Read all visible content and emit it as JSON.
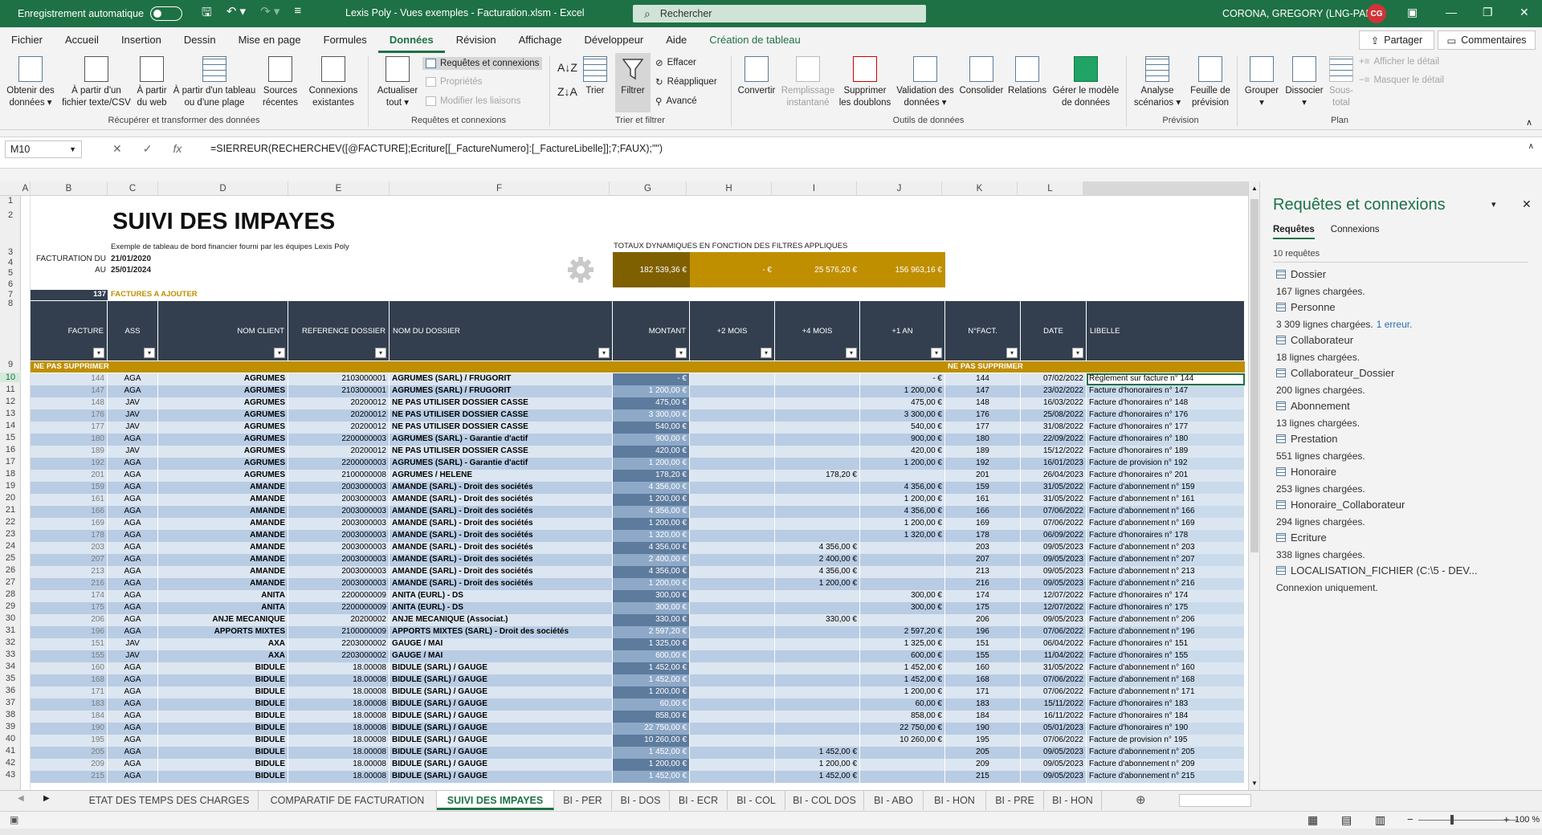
{
  "titlebar": {
    "autosave": "Enregistrement automatique",
    "title": "Lexis Poly - Vues exemples - Facturation.xlsm  -  Excel",
    "search": "Rechercher",
    "user": "CORONA, GREGORY (LNG-PAR)",
    "initials": "CG"
  },
  "menu": [
    "Fichier",
    "Accueil",
    "Insertion",
    "Dessin",
    "Mise en page",
    "Formules",
    "Données",
    "Révision",
    "Affichage",
    "Développeur",
    "Aide",
    "Création de tableau"
  ],
  "share": "Partager",
  "comments": "Commentaires",
  "ribbon": {
    "obtenir": "Obtenir des\ndonnées ▾",
    "texte": "À partir d'un\nfichier texte/CSV",
    "web": "À partir\ndu web",
    "tableau": "À partir d'un tableau\nou d'une plage",
    "sources": "Sources\nrécentes",
    "connexions": "Connexions\nexistantes",
    "actualiser": "Actualiser\ntout ▾",
    "req_conn": "Requêtes et connexions",
    "proprietes": "Propriétés",
    "modifier": "Modifier les liaisons",
    "trier": "Trier",
    "filtrer": "Filtrer",
    "effacer": "Effacer",
    "reappliquer": "Réappliquer",
    "avance": "Avancé",
    "convertir": "Convertir",
    "remplissage": "Remplissage\ninstantané",
    "supprimer": "Supprimer\nles doublons",
    "validation": "Validation des\ndonnées ▾",
    "consolider": "Consolider",
    "relations": "Relations",
    "modele": "Gérer le modèle\nde données",
    "analyse": "Analyse\nscénarios ▾",
    "feuille": "Feuille de\nprévision",
    "grouper": "Grouper\n▾",
    "dissocier": "Dissocier\n▾",
    "soustotal": "Sous-\ntotal",
    "afficher": "Afficher le détail",
    "masquer": "Masquer le détail",
    "g1": "Récupérer et transformer des données",
    "g2": "Requêtes et connexions",
    "g3": "Trier et filtrer",
    "g4": "Outils de données",
    "g5": "Prévision",
    "g6": "Plan"
  },
  "formula": {
    "cell": "M10",
    "text": "=SIERREUR(RECHERCHEV([@FACTURE];Ecriture[[_FactureNumero]:[_FactureLibelle]];7;FAUX);\"\")"
  },
  "columns": [
    "A",
    "B",
    "C",
    "D",
    "E",
    "F",
    "G",
    "H",
    "I",
    "J",
    "K",
    "L"
  ],
  "rows": [
    "1",
    "2",
    "3",
    "4",
    "5",
    "6",
    "7",
    "8",
    "9",
    "10",
    "11",
    "12",
    "13",
    "14",
    "15",
    "16",
    "17",
    "18",
    "19",
    "20",
    "21",
    "22",
    "23",
    "24",
    "25",
    "26",
    "27",
    "28",
    "29",
    "30",
    "31",
    "32",
    "33",
    "34",
    "35",
    "36",
    "37",
    "38",
    "39",
    "40",
    "41",
    "42",
    "43"
  ],
  "sheet": {
    "title": "SUIVI DES IMPAYES",
    "subtitle": "Exemple de tableau de bord financier fourni par les équipes Lexis Poly",
    "fact_du_label": "FACTURATION DU",
    "fact_du": "21/01/2020",
    "au_label": "AU",
    "au": "25/01/2024",
    "totaux_label": "TOTAUX DYNAMIQUES EN FONCTION DES FILTRES APPLIQUES",
    "totals": [
      "182 539,36 €",
      "-   €",
      "25 576,20 €",
      "156 963,16 €"
    ],
    "count": "137",
    "count_label": "FACTURES A AJOUTER",
    "headers": [
      "FACTURE",
      "ASS",
      "NOM CLIENT",
      "REFERENCE DOSSIER",
      "NOM DU DOSSIER",
      "MONTANT",
      "+2 MOIS",
      "+4 MOIS",
      "+1 AN",
      "N°FACT.",
      "DATE",
      "LIBELLE"
    ],
    "band": "NE PAS SUPPRIMER",
    "band2": "NE PAS SUPPRIMER"
  },
  "data": [
    [
      "144",
      "AGA",
      "AGRUMES",
      "2103000001",
      "AGRUMES (SARL) / FRUGORIT",
      "-   €",
      "",
      "",
      "-   €",
      "144",
      "07/02/2022",
      "Règlement sur facture n° 144"
    ],
    [
      "147",
      "AGA",
      "AGRUMES",
      "2103000001",
      "AGRUMES (SARL) / FRUGORIT",
      "1 200,00 €",
      "",
      "",
      "1 200,00 €",
      "147",
      "23/02/2022",
      "Facture d'honoraires n° 147"
    ],
    [
      "148",
      "JAV",
      "AGRUMES",
      "20200012",
      "NE PAS UTILISER DOSSIER CASSE",
      "475,00 €",
      "",
      "",
      "475,00 €",
      "148",
      "16/03/2022",
      "Facture d'honoraires n° 148"
    ],
    [
      "176",
      "JAV",
      "AGRUMES",
      "20200012",
      "NE PAS UTILISER DOSSIER CASSE",
      "3 300,00 €",
      "",
      "",
      "3 300,00 €",
      "176",
      "25/08/2022",
      "Facture d'honoraires n° 176"
    ],
    [
      "177",
      "JAV",
      "AGRUMES",
      "20200012",
      "NE PAS UTILISER DOSSIER CASSE",
      "540,00 €",
      "",
      "",
      "540,00 €",
      "177",
      "31/08/2022",
      "Facture d'honoraires n° 177"
    ],
    [
      "180",
      "AGA",
      "AGRUMES",
      "2200000003",
      "AGRUMES (SARL) - Garantie d'actif",
      "900,00 €",
      "",
      "",
      "900,00 €",
      "180",
      "22/09/2022",
      "Facture d'honoraires n° 180"
    ],
    [
      "189",
      "JAV",
      "AGRUMES",
      "20200012",
      "NE PAS UTILISER DOSSIER CASSE",
      "420,00 €",
      "",
      "",
      "420,00 €",
      "189",
      "15/12/2022",
      "Facture d'honoraires n° 189"
    ],
    [
      "192",
      "AGA",
      "AGRUMES",
      "2200000003",
      "AGRUMES (SARL) - Garantie d'actif",
      "1 200,00 €",
      "",
      "",
      "1 200,00 €",
      "192",
      "16/01/2023",
      "Facture de provision n° 192"
    ],
    [
      "201",
      "AGA",
      "AGRUMES",
      "2100000008",
      "AGRUMES / HELENE",
      "178,20 €",
      "",
      "178,20 €",
      "",
      "201",
      "26/04/2023",
      "Facture d'honoraires n° 201"
    ],
    [
      "159",
      "AGA",
      "AMANDE",
      "2003000003",
      "AMANDE (SARL) - Droit des sociétés",
      "4 356,00 €",
      "",
      "",
      "4 356,00 €",
      "159",
      "31/05/2022",
      "Facture d'abonnement n° 159"
    ],
    [
      "161",
      "AGA",
      "AMANDE",
      "2003000003",
      "AMANDE (SARL) - Droit des sociétés",
      "1 200,00 €",
      "",
      "",
      "1 200,00 €",
      "161",
      "31/05/2022",
      "Facture d'abonnement n° 161"
    ],
    [
      "166",
      "AGA",
      "AMANDE",
      "2003000003",
      "AMANDE (SARL) - Droit des sociétés",
      "4 356,00 €",
      "",
      "",
      "4 356,00 €",
      "166",
      "07/06/2022",
      "Facture d'abonnement n° 166"
    ],
    [
      "169",
      "AGA",
      "AMANDE",
      "2003000003",
      "AMANDE (SARL) - Droit des sociétés",
      "1 200,00 €",
      "",
      "",
      "1 200,00 €",
      "169",
      "07/06/2022",
      "Facture d'abonnement n° 169"
    ],
    [
      "178",
      "AGA",
      "AMANDE",
      "2003000003",
      "AMANDE (SARL) - Droit des sociétés",
      "1 320,00 €",
      "",
      "",
      "1 320,00 €",
      "178",
      "06/09/2022",
      "Facture d'honoraires n° 178"
    ],
    [
      "203",
      "AGA",
      "AMANDE",
      "2003000003",
      "AMANDE (SARL) - Droit des sociétés",
      "4 356,00 €",
      "",
      "4 356,00 €",
      "",
      "203",
      "09/05/2023",
      "Facture d'abonnement n° 203"
    ],
    [
      "207",
      "AGA",
      "AMANDE",
      "2003000003",
      "AMANDE (SARL) - Droit des sociétés",
      "2 400,00 €",
      "",
      "2 400,00 €",
      "",
      "207",
      "09/05/2023",
      "Facture d'abonnement n° 207"
    ],
    [
      "213",
      "AGA",
      "AMANDE",
      "2003000003",
      "AMANDE (SARL) - Droit des sociétés",
      "4 356,00 €",
      "",
      "4 356,00 €",
      "",
      "213",
      "09/05/2023",
      "Facture d'abonnement n° 213"
    ],
    [
      "216",
      "AGA",
      "AMANDE",
      "2003000003",
      "AMANDE (SARL) - Droit des sociétés",
      "1 200,00 €",
      "",
      "1 200,00 €",
      "",
      "216",
      "09/05/2023",
      "Facture d'abonnement n° 216"
    ],
    [
      "174",
      "AGA",
      "ANITA",
      "2200000009",
      "ANITA (EURL) - DS",
      "300,00 €",
      "",
      "",
      "300,00 €",
      "174",
      "12/07/2022",
      "Facture d'honoraires n° 174"
    ],
    [
      "175",
      "AGA",
      "ANITA",
      "2200000009",
      "ANITA (EURL) - DS",
      "300,00 €",
      "",
      "",
      "300,00 €",
      "175",
      "12/07/2022",
      "Facture d'honoraires n° 175"
    ],
    [
      "206",
      "AGA",
      "ANJE MECANIQUE",
      "20200002",
      "ANJE MECANIQUE (Associat.)",
      "330,00 €",
      "",
      "330,00 €",
      "",
      "206",
      "09/05/2023",
      "Facture d'abonnement n° 206"
    ],
    [
      "196",
      "AGA",
      "APPORTS MIXTES",
      "2100000009",
      "APPORTS MIXTES (SARL) - Droit des sociétés",
      "2 597,20 €",
      "",
      "",
      "2 597,20 €",
      "196",
      "07/06/2022",
      "Facture d'abonnement n° 196"
    ],
    [
      "151",
      "JAV",
      "AXA",
      "2203000002",
      "GAUGE / MAI",
      "1 325,00 €",
      "",
      "",
      "1 325,00 €",
      "151",
      "06/04/2022",
      "Facture d'honoraires n° 151"
    ],
    [
      "155",
      "JAV",
      "AXA",
      "2203000002",
      "GAUGE / MAI",
      "600,00 €",
      "",
      "",
      "600,00 €",
      "155",
      "11/04/2022",
      "Facture d'honoraires n° 155"
    ],
    [
      "160",
      "AGA",
      "BIDULE",
      "18.00008",
      "BIDULE (SARL) / GAUGE",
      "1 452,00 €",
      "",
      "",
      "1 452,00 €",
      "160",
      "31/05/2022",
      "Facture d'abonnement n° 160"
    ],
    [
      "168",
      "AGA",
      "BIDULE",
      "18.00008",
      "BIDULE (SARL) / GAUGE",
      "1 452,00 €",
      "",
      "",
      "1 452,00 €",
      "168",
      "07/06/2022",
      "Facture d'abonnement n° 168"
    ],
    [
      "171",
      "AGA",
      "BIDULE",
      "18.00008",
      "BIDULE (SARL) / GAUGE",
      "1 200,00 €",
      "",
      "",
      "1 200,00 €",
      "171",
      "07/06/2022",
      "Facture d'abonnement n° 171"
    ],
    [
      "183",
      "AGA",
      "BIDULE",
      "18.00008",
      "BIDULE (SARL) / GAUGE",
      "60,00 €",
      "",
      "",
      "60,00 €",
      "183",
      "15/11/2022",
      "Facture d'honoraires n° 183"
    ],
    [
      "184",
      "AGA",
      "BIDULE",
      "18.00008",
      "BIDULE (SARL) / GAUGE",
      "858,00 €",
      "",
      "",
      "858,00 €",
      "184",
      "16/11/2022",
      "Facture d'honoraires n° 184"
    ],
    [
      "190",
      "AGA",
      "BIDULE",
      "18.00008",
      "BIDULE (SARL) / GAUGE",
      "22 750,00 €",
      "",
      "",
      "22 750,00 €",
      "190",
      "05/01/2023",
      "Facture d'honoraires n° 190"
    ],
    [
      "195",
      "AGA",
      "BIDULE",
      "18.00008",
      "BIDULE (SARL) / GAUGE",
      "10 260,00 €",
      "",
      "",
      "10 260,00 €",
      "195",
      "07/06/2022",
      "Facture de provision n° 195"
    ],
    [
      "205",
      "AGA",
      "BIDULE",
      "18.00008",
      "BIDULE (SARL) / GAUGE",
      "1 452,00 €",
      "",
      "1 452,00 €",
      "",
      "205",
      "09/05/2023",
      "Facture d'abonnement n° 205"
    ],
    [
      "209",
      "AGA",
      "BIDULE",
      "18.00008",
      "BIDULE (SARL) / GAUGE",
      "1 200,00 €",
      "",
      "1 200,00 €",
      "",
      "209",
      "09/05/2023",
      "Facture d'abonnement n° 209"
    ],
    [
      "215",
      "AGA",
      "BIDULE",
      "18.00008",
      "BIDULE (SARL) / GAUGE",
      "1 452,00 €",
      "",
      "1 452,00 €",
      "",
      "215",
      "09/05/2023",
      "Facture d'abonnement n° 215"
    ]
  ],
  "panel": {
    "title": "Requêtes et connexions",
    "tab1": "Requêtes",
    "tab2": "Connexions",
    "count": "10 requêtes",
    "items": [
      {
        "name": "Dossier",
        "desc": "167 lignes chargées."
      },
      {
        "name": "Personne",
        "desc": "3 309 lignes chargées.",
        "err": "1 erreur."
      },
      {
        "name": "Collaborateur",
        "desc": "18 lignes chargées."
      },
      {
        "name": "Collaborateur_Dossier",
        "desc": "200 lignes chargées."
      },
      {
        "name": "Abonnement",
        "desc": "13 lignes chargées."
      },
      {
        "name": "Prestation",
        "desc": "551 lignes chargées."
      },
      {
        "name": "Honoraire",
        "desc": "253 lignes chargées."
      },
      {
        "name": "Honoraire_Collaborateur",
        "desc": "294 lignes chargées."
      },
      {
        "name": "Ecriture",
        "desc": "338 lignes chargées."
      },
      {
        "name": "LOCALISATION_FICHIER (C:\\5 - DEV...",
        "desc": "Connexion uniquement."
      }
    ]
  },
  "tabs": [
    "ETAT DES TEMPS DES CHARGES",
    "COMPARATIF DE FACTURATION",
    "SUIVI DES IMPAYES",
    "BI - PER",
    "BI - DOS",
    "BI - ECR",
    "BI - COL",
    "BI - COL DOS",
    "BI - ABO",
    "BI - HON",
    "BI - PRE",
    "BI - HON"
  ],
  "zoom": "100 %"
}
